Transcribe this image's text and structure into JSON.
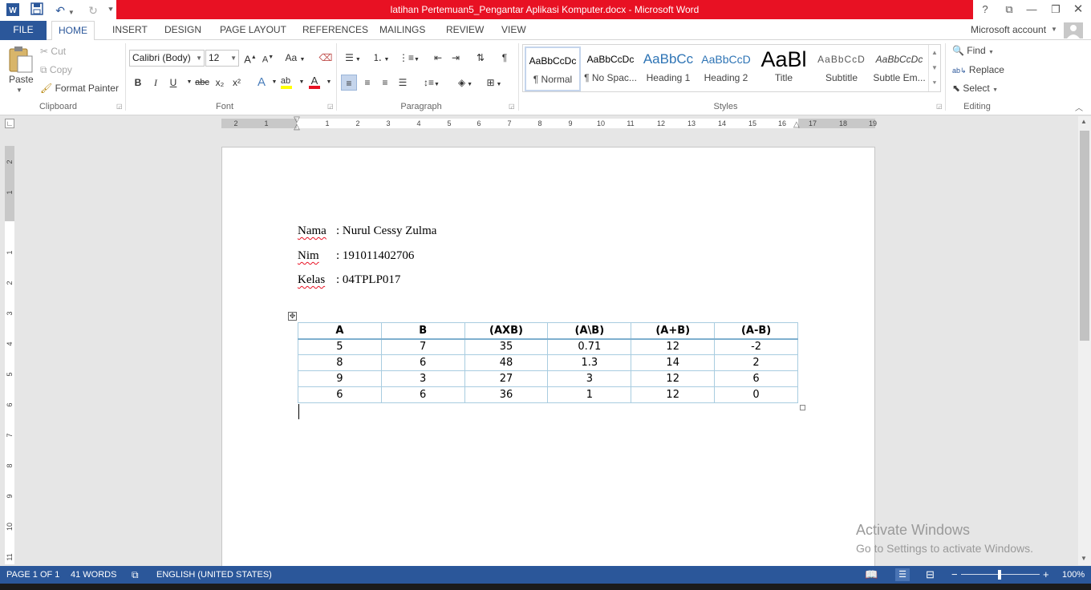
{
  "title_bar": {
    "document_title": "latihan Pertemuan5_Pengantar Aplikasi Komputer.docx - Microsoft Word",
    "help": "?",
    "window_controls": [
      "restore-ribbon",
      "minimize",
      "maximize",
      "close"
    ]
  },
  "tabs": {
    "file": "FILE",
    "items": [
      "HOME",
      "INSERT",
      "DESIGN",
      "PAGE LAYOUT",
      "REFERENCES",
      "MAILINGS",
      "REVIEW",
      "VIEW"
    ],
    "active": "HOME",
    "account": "Microsoft account"
  },
  "ribbon": {
    "clipboard": {
      "label": "Clipboard",
      "paste": "Paste",
      "cut": "Cut",
      "copy": "Copy",
      "format_painter": "Format Painter"
    },
    "font": {
      "label": "Font",
      "font_name": "Calibri (Body)",
      "font_size": "12",
      "bold": "B",
      "italic": "I",
      "underline": "U",
      "strike": "abc",
      "subscript": "x₂",
      "superscript": "x²",
      "grow": "A",
      "change_case": "Aa",
      "font_color": "#e81123",
      "highlight_color": "#ffff00"
    },
    "paragraph": {
      "label": "Paragraph"
    },
    "styles": {
      "label": "Styles",
      "items": [
        {
          "preview": "AaBbCcDc",
          "name": "¶ Normal"
        },
        {
          "preview": "AaBbCcDc",
          "name": "¶ No Spac..."
        },
        {
          "preview": "AaBbCc",
          "name": "Heading 1"
        },
        {
          "preview": "AaBbCcD",
          "name": "Heading 2"
        },
        {
          "preview": "AaBl",
          "name": "Title"
        },
        {
          "preview": "AaBbCcD",
          "name": "Subtitle"
        },
        {
          "preview": "AaBbCcDc",
          "name": "Subtle Em..."
        }
      ]
    },
    "editing": {
      "label": "Editing",
      "find": "Find",
      "replace": "Replace",
      "select": "Select"
    }
  },
  "ruler": {
    "h_numbers": [
      "2",
      "1",
      "1",
      "2",
      "3",
      "4",
      "5",
      "6",
      "7",
      "8",
      "9",
      "10",
      "11",
      "12",
      "13",
      "14",
      "15",
      "16",
      "17",
      "18",
      "19"
    ],
    "v_numbers": [
      "2",
      "1",
      "1",
      "1",
      "2",
      "3",
      "4",
      "5",
      "6",
      "7",
      "8",
      "9",
      "10",
      "11"
    ]
  },
  "document": {
    "lines": [
      {
        "label": "Nama",
        "value": ": Nurul Cessy Zulma"
      },
      {
        "label": "Nim",
        "value": ": 191011402706"
      },
      {
        "label": "Kelas",
        "value": ": 04TPLP017"
      }
    ],
    "table": {
      "headers": [
        "A",
        "B",
        "(AXB)",
        "(A\\B)",
        "(A+B)",
        "(A-B)"
      ],
      "rows": [
        [
          "5",
          "7",
          "35",
          "0.71",
          "12",
          "-2"
        ],
        [
          "8",
          "6",
          "48",
          "1.3",
          "14",
          "2"
        ],
        [
          "9",
          "3",
          "27",
          "3",
          "12",
          "6"
        ],
        [
          "6",
          "6",
          "36",
          "1",
          "12",
          "0"
        ]
      ]
    }
  },
  "status_bar": {
    "page": "PAGE 1 OF 1",
    "words": "41 WORDS",
    "language": "ENGLISH (UNITED STATES)",
    "zoom": "100%"
  },
  "watermark": {
    "line1": "Activate Windows",
    "line2": "Go to Settings to activate Windows."
  }
}
